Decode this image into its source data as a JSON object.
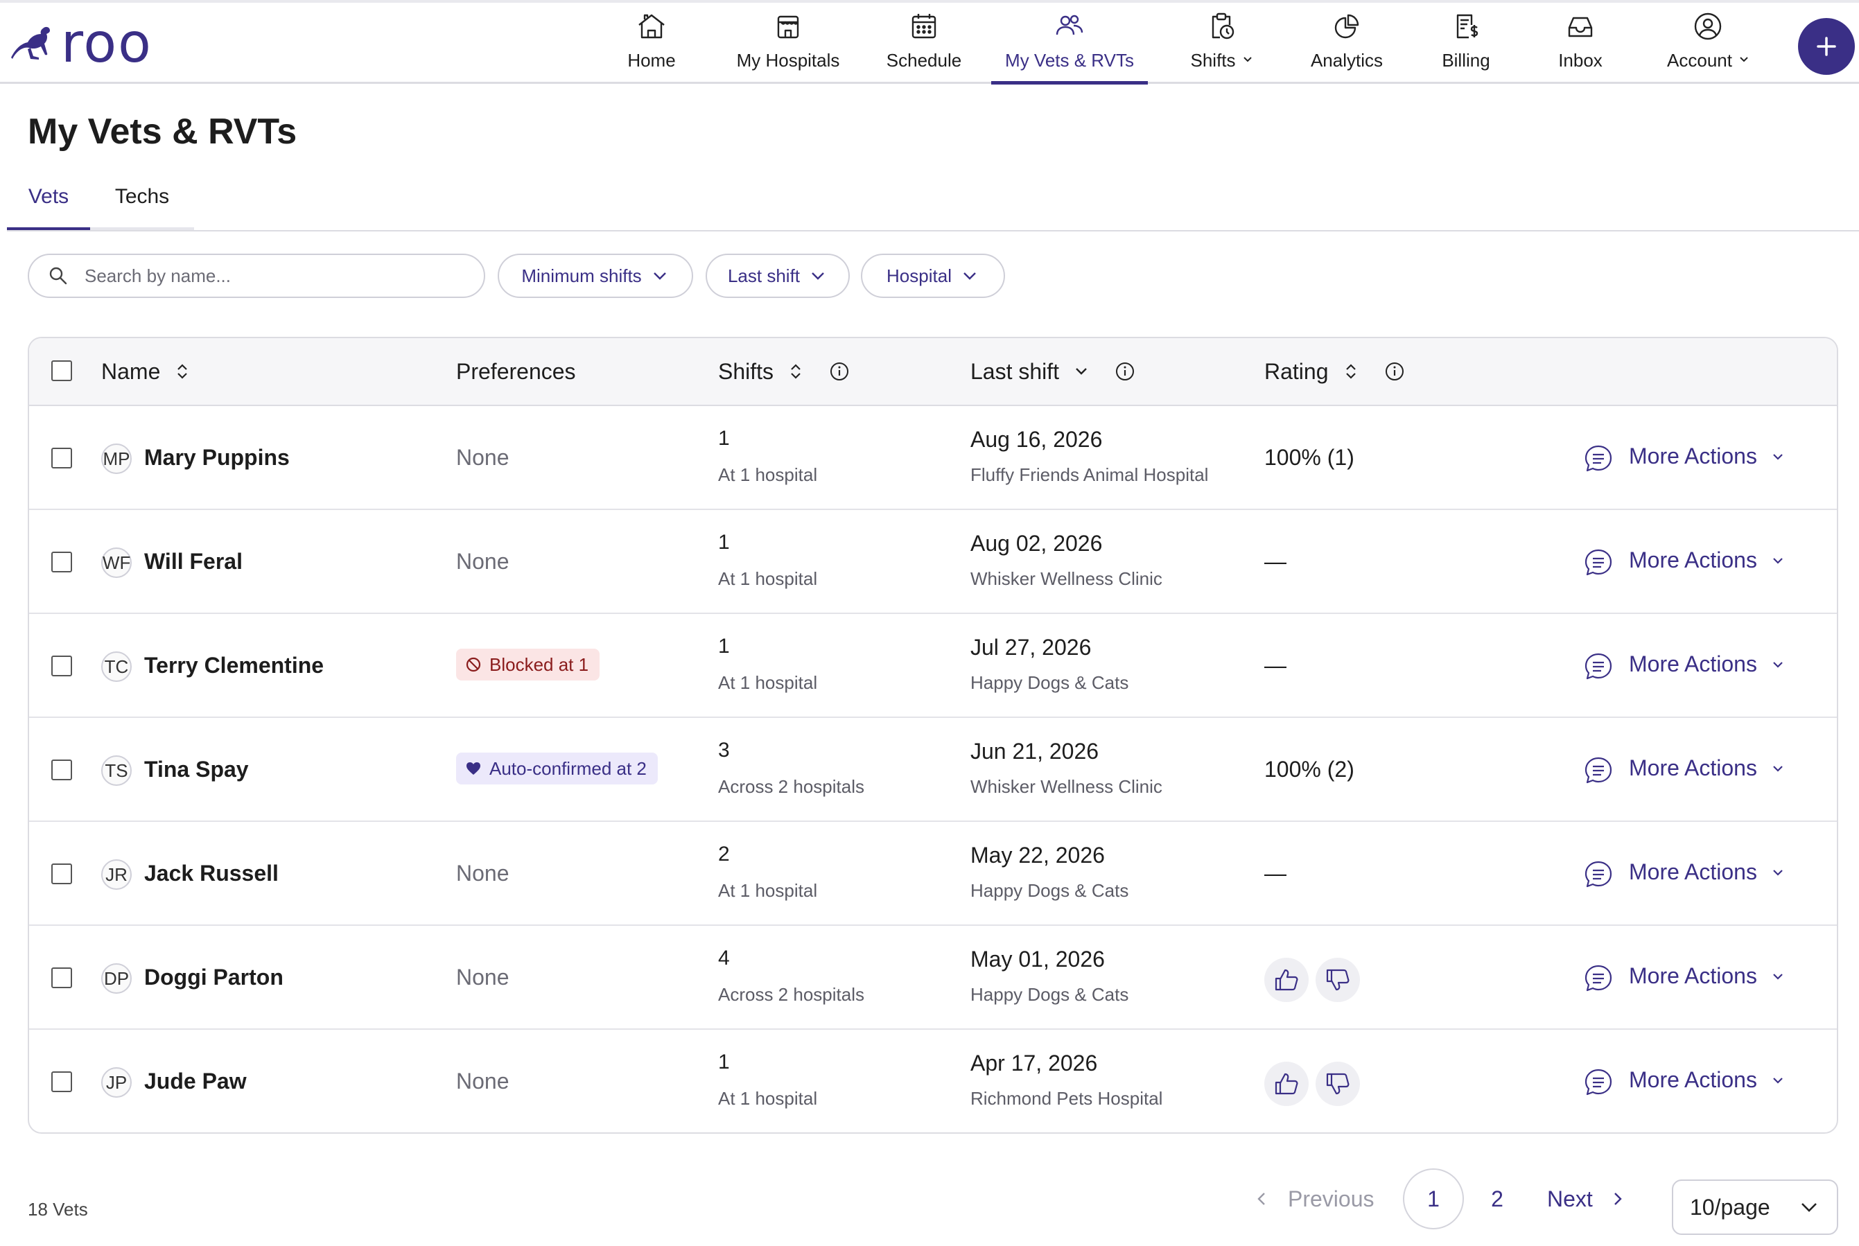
{
  "brand": {
    "name": "roo",
    "color": "#3a2f86"
  },
  "nav": {
    "items": [
      {
        "label": "Home",
        "icon": "home-icon"
      },
      {
        "label": "My Hospitals",
        "icon": "hospital-icon"
      },
      {
        "label": "Schedule",
        "icon": "calendar-icon"
      },
      {
        "label": "My Vets & RVTs",
        "icon": "people-icon",
        "active": true
      },
      {
        "label": "Shifts",
        "icon": "clipboard-clock-icon",
        "dropdown": true
      },
      {
        "label": "Analytics",
        "icon": "pie-chart-icon"
      },
      {
        "label": "Billing",
        "icon": "invoice-dollar-icon"
      },
      {
        "label": "Inbox",
        "icon": "inbox-icon"
      },
      {
        "label": "Account",
        "icon": "user-circle-icon",
        "dropdown": true
      }
    ],
    "fab_icon": "plus-icon"
  },
  "page": {
    "title": "My Vets & RVTs",
    "tabs": [
      {
        "label": "Vets",
        "active": true
      },
      {
        "label": "Techs"
      }
    ]
  },
  "filters": {
    "search_placeholder": "Search by name...",
    "search_value": "",
    "dropdowns": [
      "Minimum shifts",
      "Last shift",
      "Hospital"
    ]
  },
  "table": {
    "headers": {
      "name": "Name",
      "preferences": "Preferences",
      "shifts": "Shifts",
      "last_shift": "Last shift",
      "rating": "Rating"
    },
    "more_label": "More Actions",
    "rows": [
      {
        "initials": "MP",
        "name": "Mary Puppins",
        "preference": "None",
        "pref_type": "none",
        "shifts": "1",
        "shifts_sub": "At 1 hospital",
        "last_date": "Aug 16, 2026",
        "last_hospital": "Fluffy Friends Animal Hospital",
        "rating_type": "text",
        "rating": "100% (1)"
      },
      {
        "initials": "WF",
        "name": "Will Feral",
        "preference": "None",
        "pref_type": "none",
        "shifts": "1",
        "shifts_sub": "At 1 hospital",
        "last_date": "Aug 02, 2026",
        "last_hospital": "Whisker Wellness Clinic",
        "rating_type": "text",
        "rating": "—"
      },
      {
        "initials": "TC",
        "name": "Terry Clementine",
        "preference": "Blocked at 1",
        "pref_type": "blocked",
        "shifts": "1",
        "shifts_sub": "At 1 hospital",
        "last_date": "Jul 27, 2026",
        "last_hospital": "Happy Dogs & Cats",
        "rating_type": "text",
        "rating": "—"
      },
      {
        "initials": "TS",
        "name": "Tina Spay",
        "preference": "Auto-confirmed at 2",
        "pref_type": "auto",
        "shifts": "3",
        "shifts_sub": "Across 2 hospitals",
        "last_date": "Jun 21, 2026",
        "last_hospital": "Whisker Wellness Clinic",
        "rating_type": "text",
        "rating": "100% (2)"
      },
      {
        "initials": "JR",
        "name": "Jack Russell",
        "preference": "None",
        "pref_type": "none",
        "shifts": "2",
        "shifts_sub": "At 1 hospital",
        "last_date": "May 22, 2026",
        "last_hospital": "Happy Dogs & Cats",
        "rating_type": "text",
        "rating": "—"
      },
      {
        "initials": "DP",
        "name": "Doggi Parton",
        "preference": "None",
        "pref_type": "none",
        "shifts": "4",
        "shifts_sub": "Across 2 hospitals",
        "last_date": "May 01, 2026",
        "last_hospital": "Happy Dogs & Cats",
        "rating_type": "thumbs",
        "rating": ""
      },
      {
        "initials": "JP",
        "name": "Jude Paw",
        "preference": "None",
        "pref_type": "none",
        "shifts": "1",
        "shifts_sub": "At 1 hospital",
        "last_date": "Apr 17, 2026",
        "last_hospital": "Richmond Pets Hospital",
        "rating_type": "thumbs",
        "rating": ""
      }
    ]
  },
  "footer": {
    "count": "18 Vets",
    "previous": "Previous",
    "pages": [
      "1",
      "2"
    ],
    "current_page": "1",
    "next": "Next",
    "per_page": "10/page"
  }
}
